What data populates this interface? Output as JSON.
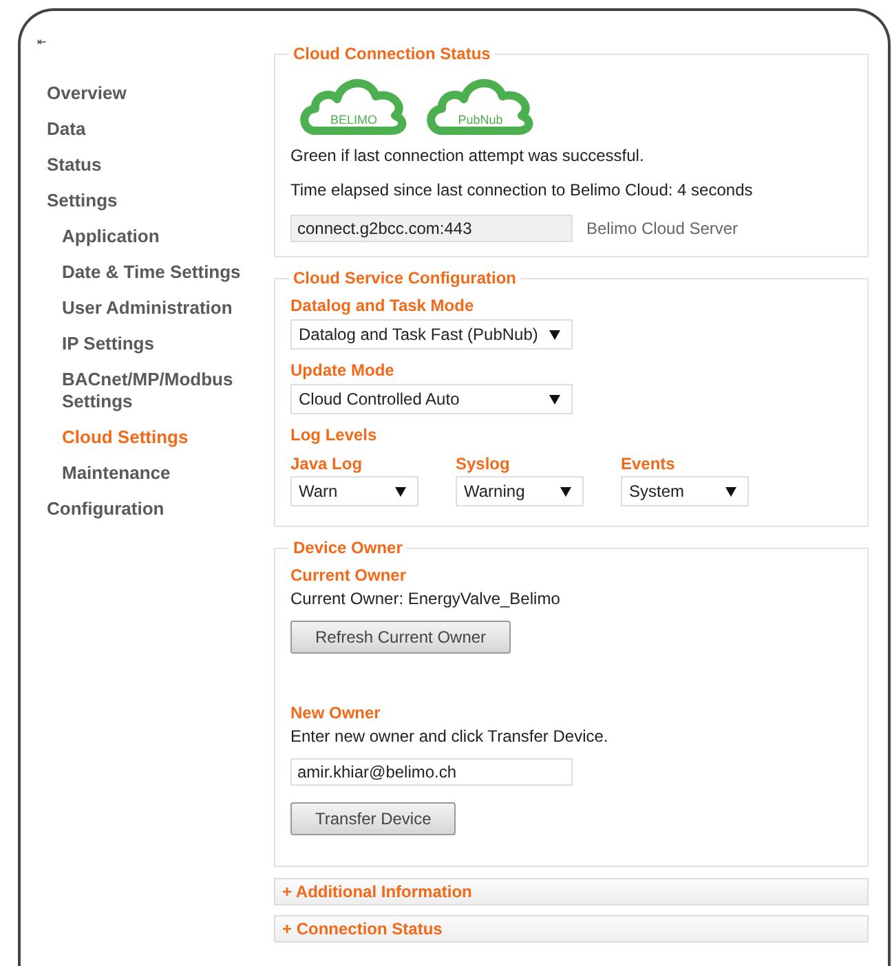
{
  "collapse_icon": "⇤",
  "sidebar": {
    "items": [
      {
        "label": "Overview",
        "selected": false
      },
      {
        "label": "Data",
        "selected": false
      },
      {
        "label": "Status",
        "selected": false
      },
      {
        "label": "Settings",
        "selected": false,
        "children": [
          {
            "label": "Application",
            "selected": false
          },
          {
            "label": "Date & Time Settings",
            "selected": false
          },
          {
            "label": "User Administration",
            "selected": false
          },
          {
            "label": "IP Settings",
            "selected": false
          },
          {
            "label": "BACnet/MP/Modbus Settings",
            "selected": false
          },
          {
            "label": "Cloud Settings",
            "selected": true
          },
          {
            "label": "Maintenance",
            "selected": false
          }
        ]
      },
      {
        "label": "Configuration",
        "selected": false
      }
    ]
  },
  "cloud_status": {
    "legend": "Cloud Connection Status",
    "clouds": [
      {
        "label": "BELIMO",
        "connected": true
      },
      {
        "label": "PubNub",
        "connected": true
      }
    ],
    "note": "Green if last connection attempt was successful.",
    "elapsed": "Time elapsed since last connection to Belimo Cloud: 4 seconds",
    "server": {
      "value": "connect.g2bcc.com:443",
      "label": "Belimo Cloud Server"
    }
  },
  "service_config": {
    "legend": "Cloud Service Configuration",
    "datalog_mode": {
      "label": "Datalog and Task Mode",
      "value": "Datalog and Task Fast (PubNub)"
    },
    "update_mode": {
      "label": "Update Mode",
      "value": "Cloud Controlled Auto"
    },
    "log_levels": {
      "label": "Log Levels",
      "items": [
        {
          "label": "Java Log",
          "value": "Warn"
        },
        {
          "label": "Syslog",
          "value": "Warning"
        },
        {
          "label": "Events",
          "value": "System"
        }
      ]
    }
  },
  "device_owner": {
    "legend": "Device Owner",
    "current_heading": "Current Owner",
    "current_text": "Current Owner: EnergyValve_Belimo",
    "refresh_button": "Refresh Current Owner",
    "new_heading": "New Owner",
    "new_text": "Enter new owner and click Transfer Device.",
    "new_value": "amir.khiar@belimo.ch",
    "transfer_button": "Transfer Device"
  },
  "panels": [
    {
      "toggle": "+",
      "label": "Additional Information",
      "expanded": false
    },
    {
      "toggle": "+",
      "label": "Connection Status",
      "expanded": false
    }
  ]
}
